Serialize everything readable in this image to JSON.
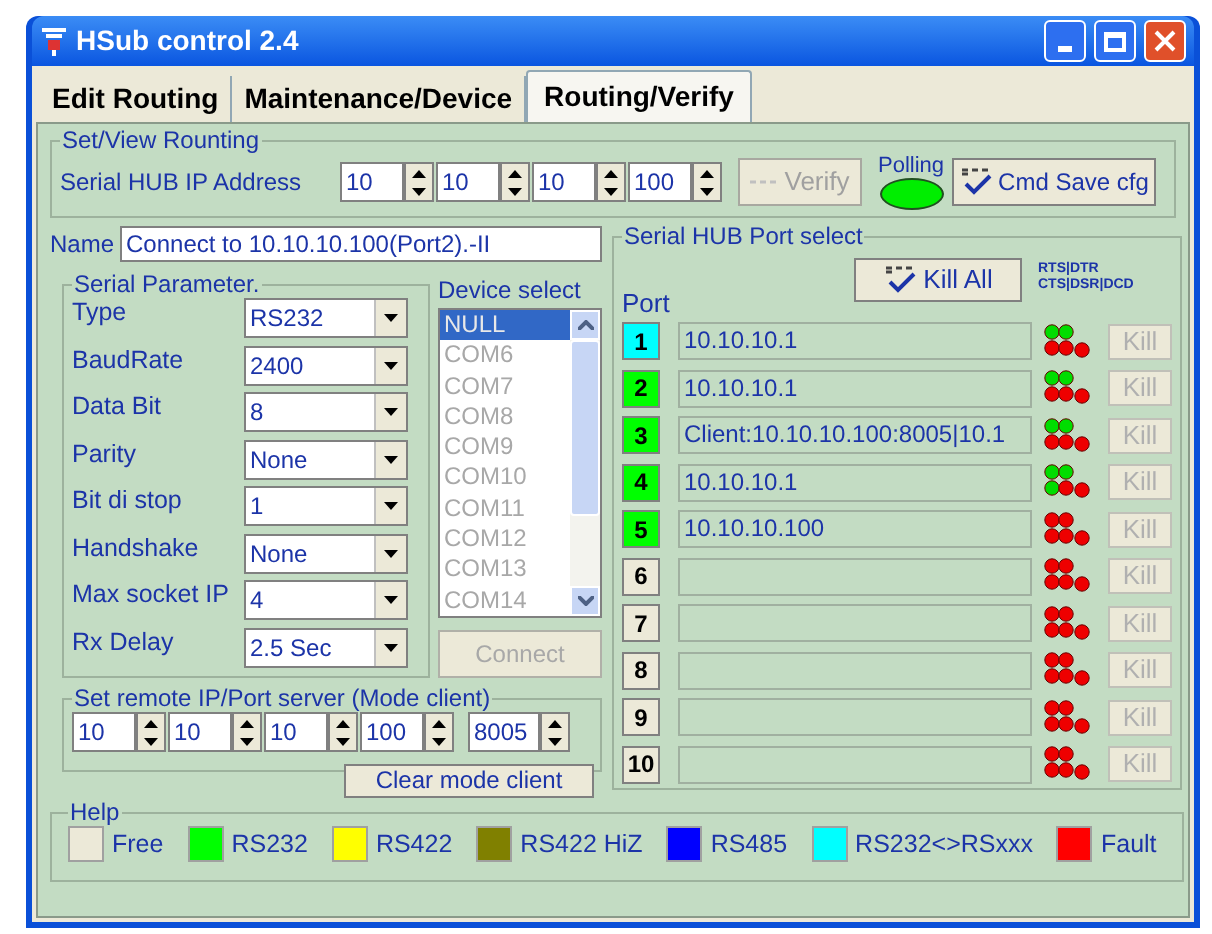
{
  "window": {
    "title": "HSub control 2.4"
  },
  "tabs": [
    {
      "label": "Edit Routing",
      "selected": false
    },
    {
      "label": "Maintenance/Device",
      "selected": false
    },
    {
      "label": "Routing/Verify",
      "selected": true
    }
  ],
  "set_view_routing": {
    "title": "Set/View Rounting",
    "ip_label": "Serial HUB IP Address",
    "ip": [
      "10",
      "10",
      "10",
      "100"
    ],
    "verify_button": {
      "label": "Verify",
      "disabled": true
    },
    "polling": {
      "label": "Polling",
      "on": true
    },
    "save_button": "Cmd Save cfg"
  },
  "name": {
    "label": "Name",
    "value": "Connect to 10.10.10.100(Port2).-II"
  },
  "serial_parameter": {
    "title": "Serial Parameter.",
    "fields": [
      {
        "label": "Type",
        "value": "RS232"
      },
      {
        "label": "BaudRate",
        "value": "2400"
      },
      {
        "label": "Data Bit",
        "value": "8"
      },
      {
        "label": "Parity",
        "value": "None"
      },
      {
        "label": "Bit di stop",
        "value": "1"
      },
      {
        "label": "Handshake",
        "value": "None"
      },
      {
        "label": "Max socket IP",
        "value": "4"
      },
      {
        "label": "Rx Delay",
        "value": "2.5 Sec"
      }
    ]
  },
  "device_select": {
    "title": "Device select",
    "items": [
      {
        "label": "NULL",
        "selected": true
      },
      {
        "label": "COM6",
        "selected": false
      },
      {
        "label": "COM7",
        "selected": false
      },
      {
        "label": "COM8",
        "selected": false
      },
      {
        "label": "COM9",
        "selected": false
      },
      {
        "label": "COM10",
        "selected": false
      },
      {
        "label": "COM11",
        "selected": false
      },
      {
        "label": "COM12",
        "selected": false
      },
      {
        "label": "COM13",
        "selected": false
      },
      {
        "label": "COM14",
        "selected": false
      }
    ],
    "connect_button": {
      "label": "Connect",
      "disabled": true
    }
  },
  "remote": {
    "title": "Set remote IP/Port server (Mode client)",
    "ip": [
      "10",
      "10",
      "10",
      "100"
    ],
    "port": "8005",
    "clear_button": "Clear mode client"
  },
  "port_select": {
    "title": "Serial HUB Port select",
    "kill_all": "Kill All",
    "port_header": "Port",
    "led_header": [
      "RTS|DTR",
      "CTS|DSR|DCD"
    ],
    "ports": [
      {
        "number": "1",
        "color": "#00ffff",
        "value": "10.10.10.1",
        "leds": [
          true,
          true,
          false,
          false,
          false
        ],
        "kill": {
          "label": "Kill",
          "disabled": true
        }
      },
      {
        "number": "2",
        "color": "#00ff00",
        "value": "10.10.10.1",
        "leds": [
          true,
          true,
          false,
          false,
          false
        ],
        "kill": {
          "label": "Kill",
          "disabled": true
        }
      },
      {
        "number": "3",
        "color": "#00ff00",
        "value": "Client:10.10.10.100:8005|10.1",
        "leds": [
          true,
          true,
          false,
          false,
          false
        ],
        "kill": {
          "label": "Kill",
          "disabled": true
        }
      },
      {
        "number": "4",
        "color": "#00ff00",
        "value": "10.10.10.1",
        "leds": [
          true,
          true,
          true,
          false,
          false
        ],
        "kill": {
          "label": "Kill",
          "disabled": true
        }
      },
      {
        "number": "5",
        "color": "#00ff00",
        "value": "10.10.10.100",
        "leds": [
          false,
          false,
          false,
          false,
          false
        ],
        "kill": {
          "label": "Kill",
          "disabled": true
        }
      },
      {
        "number": "6",
        "color": "#ece9d8",
        "leds": [
          false,
          false,
          false,
          false,
          false
        ],
        "kill": {
          "label": "Kill",
          "disabled": true
        }
      },
      {
        "number": "7",
        "color": "#ece9d8",
        "leds": [
          false,
          false,
          false,
          false,
          false
        ],
        "kill": {
          "label": "Kill",
          "disabled": true
        }
      },
      {
        "number": "8",
        "color": "#ece9d8",
        "leds": [
          false,
          false,
          false,
          false,
          false
        ],
        "kill": {
          "label": "Kill",
          "disabled": true
        }
      },
      {
        "number": "9",
        "color": "#ece9d8",
        "leds": [
          false,
          false,
          false,
          false,
          false
        ],
        "kill": {
          "label": "Kill",
          "disabled": true
        }
      },
      {
        "number": "10",
        "color": "#ece9d8",
        "leds": [
          false,
          false,
          false,
          false,
          false
        ],
        "kill": {
          "label": "Kill",
          "disabled": true
        }
      }
    ]
  },
  "help": {
    "title": "Help",
    "items": [
      {
        "label": "Free",
        "color": "#ece9d8"
      },
      {
        "label": "RS232",
        "color": "#00ff00"
      },
      {
        "label": "RS422",
        "color": "#ffff00"
      },
      {
        "label": "RS422 HiZ",
        "color": "#808000"
      },
      {
        "label": "RS485",
        "color": "#0000ff"
      },
      {
        "label": "RS232<>RSxxx",
        "color": "#00ffff"
      },
      {
        "label": "Fault",
        "color": "#ff0000"
      }
    ]
  }
}
